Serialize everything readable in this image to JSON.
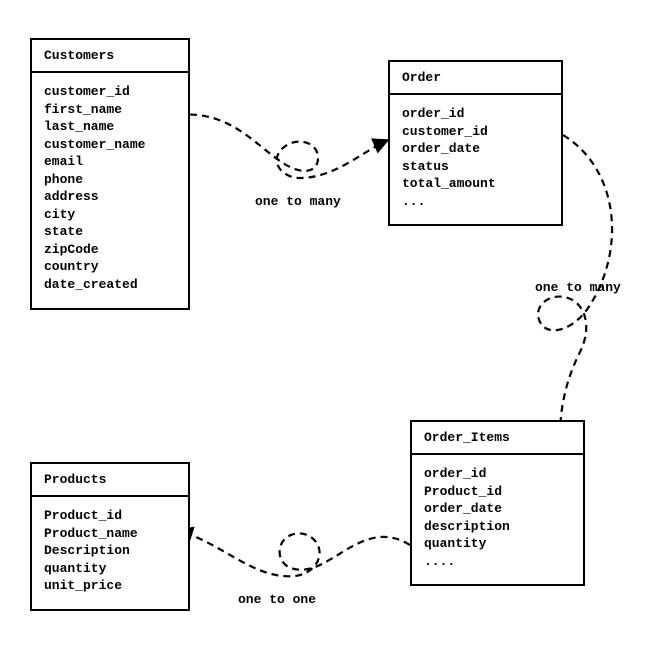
{
  "entities": {
    "customers": {
      "title": "Customers",
      "fields": [
        "customer_id",
        "first_name",
        "last_name",
        "customer_name",
        "email",
        "phone",
        "address",
        "city",
        "state",
        "zipCode",
        "country",
        "date_created"
      ]
    },
    "order": {
      "title": "Order",
      "fields": [
        "order_id",
        "customer_id",
        "order_date",
        "status",
        "total_amount",
        "..."
      ]
    },
    "order_items": {
      "title": "Order_Items",
      "fields": [
        "order_id",
        "Product_id",
        "order_date",
        "description",
        "quantity",
        "...."
      ]
    },
    "products": {
      "title": "Products",
      "fields": [
        "Product_id",
        "Product_name",
        "Description",
        "quantity",
        "unit_price"
      ]
    }
  },
  "relations": {
    "cust_to_order": "one to many",
    "order_to_items": "one to many",
    "items_to_products": "one to one"
  }
}
